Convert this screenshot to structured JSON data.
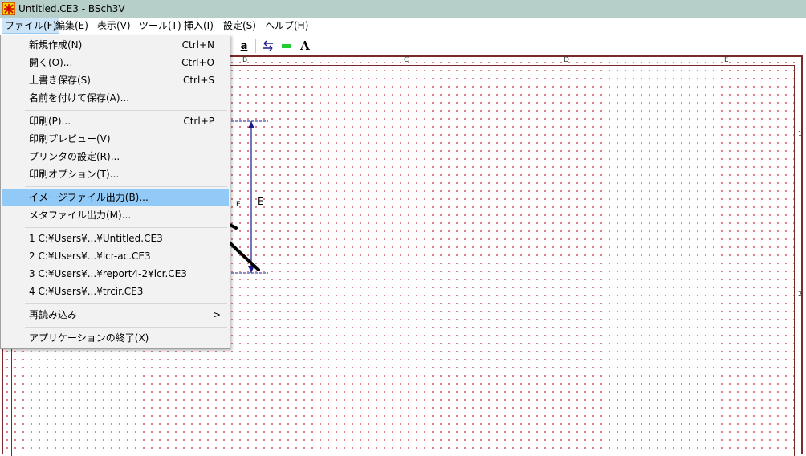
{
  "window": {
    "title": "Untitled.CE3 - BSch3V"
  },
  "menubar": [
    {
      "label": "ファイル(F)",
      "active": true
    },
    {
      "label": "編集(E)"
    },
    {
      "label": "表示(V)"
    },
    {
      "label": "ツール(T)"
    },
    {
      "label": "挿入(I)"
    },
    {
      "label": "設定(S)"
    },
    {
      "label": "ヘルプ(H)"
    }
  ],
  "file_menu": {
    "items": [
      {
        "label": "新規作成(N)",
        "shortcut": "Ctrl+N"
      },
      {
        "label": "開く(O)...",
        "shortcut": "Ctrl+O"
      },
      {
        "label": "上書き保存(S)",
        "shortcut": "Ctrl+S"
      },
      {
        "label": "名前を付けて保存(A)..."
      },
      {
        "label": "印刷(P)...",
        "shortcut": "Ctrl+P"
      },
      {
        "label": "印刷プレビュー(V)"
      },
      {
        "label": "プリンタの設定(R)..."
      },
      {
        "label": "印刷オプション(T)..."
      },
      {
        "label": "イメージファイル出力(B)...",
        "highlighted": true
      },
      {
        "label": "メタファイル出力(M)..."
      },
      {
        "label": "1 C:¥Users¥...¥Untitled.CE3"
      },
      {
        "label": "2 C:¥Users¥...¥lcr-ac.CE3"
      },
      {
        "label": "3 C:¥Users¥...¥report4-2¥lcr.CE3"
      },
      {
        "label": "4 C:¥Users¥...¥trcir.CE3"
      },
      {
        "label": "再読み込み",
        "submenu_arrow": ">"
      },
      {
        "label": "アプリケーションの終了(X)"
      }
    ]
  },
  "toolbar": {
    "text_tool_label": "A",
    "underline_label": "a"
  },
  "sheet": {
    "column_labels": [
      "B",
      "C",
      "D",
      "E"
    ],
    "row_labels": [
      "1",
      "2"
    ],
    "annotation_labels": [
      "E",
      "E"
    ]
  },
  "colors": {
    "titlebar": "#b7cfc9",
    "highlight": "#91c9f7",
    "frame": "#7a2a2a",
    "grid_dot": "#d65a6a",
    "dimension_line": "#1a1a8c"
  }
}
